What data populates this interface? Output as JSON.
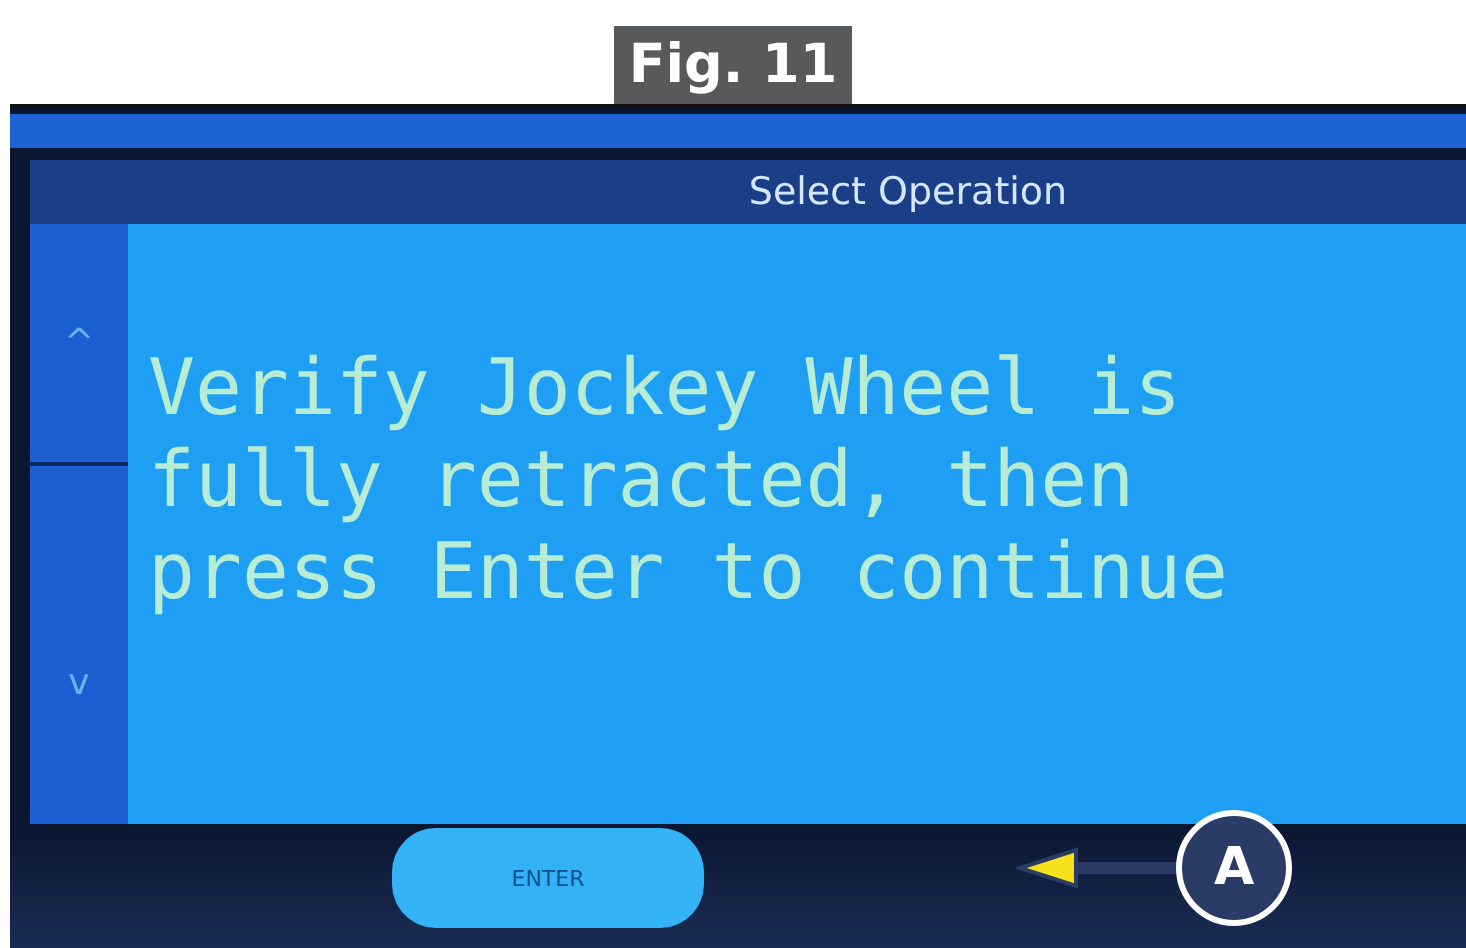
{
  "figure_label": "Fig. 11",
  "screen": {
    "title": "Select Operation",
    "scroll_buttons": [
      {
        "kind": "up",
        "label": "^"
      },
      {
        "kind": "down",
        "label": "v"
      }
    ],
    "message": "Verify Jockey Wheel is\nfully retracted, then\npress Enter to continue",
    "enter_button": "ENTER"
  },
  "callout": {
    "label": "A"
  }
}
